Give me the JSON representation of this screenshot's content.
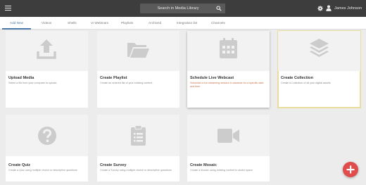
{
  "header": {
    "search_label": "Search in Media Library",
    "user_name": "James Johnson",
    "icons": [
      "menu-icon",
      "search-icon",
      "gear-icon",
      "user-icon"
    ]
  },
  "tabs": [
    {
      "label": "Add New",
      "active": true
    },
    {
      "label": "Videos"
    },
    {
      "label": "Shells"
    },
    {
      "label": "Vi Webinars"
    },
    {
      "label": "Playlists"
    },
    {
      "label": "Archived"
    },
    {
      "label": "Integration list"
    },
    {
      "label": "Channels"
    }
  ],
  "cards": [
    {
      "title": "Upload Media",
      "description": "Select a file from your computer to upload.",
      "icon": "upload-icon"
    },
    {
      "title": "Create Playlist",
      "description": "Create an ordered list of your existing content",
      "icon": "folder-icon"
    },
    {
      "title": "Schedule Live Webcast",
      "description": "Schedule a live streaming session in advance for a specific date and time.",
      "icon": "calendar-icon"
    },
    {
      "title": "Create Collection",
      "description": "Create a Collection of all your digital assets",
      "icon": "stack-icon"
    },
    {
      "title": "Create Quiz",
      "description": "Create a Quiz using multiple choice or descriptive questions",
      "icon": "question-icon"
    },
    {
      "title": "Create Survey",
      "description": "Create a Survey using multiple choice or descriptive questions",
      "icon": "clipboard-icon"
    },
    {
      "title": "Create Mosaic",
      "description": "Create a mosaic using existing content in studio space",
      "icon": "video-camera-icon"
    }
  ],
  "fab": {
    "icon": "plus-icon"
  },
  "colors": {
    "topbar": "#3d3d3d",
    "tab_active": "#4a78a8",
    "selected_border": "#e9dd9b",
    "fab": "#e04b4b",
    "accent_text": "#c9704c"
  }
}
